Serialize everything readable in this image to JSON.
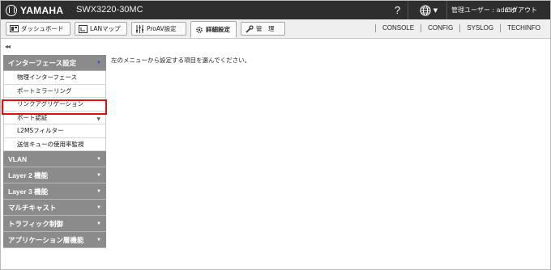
{
  "header": {
    "brand": "YAMAHA",
    "model": "SWX3220-30MC",
    "help": "?",
    "user_label": "管理ユーザー : admin",
    "logout": "ログアウト"
  },
  "nav": {
    "tabs": [
      {
        "label": "ダッシュボード",
        "icon": "dashboard-icon"
      },
      {
        "label": "LANマップ",
        "icon": "lanmap-icon"
      },
      {
        "label": "ProAV設定",
        "icon": "sliders-icon"
      },
      {
        "label": "詳細設定",
        "icon": "gear-icon",
        "active": true
      },
      {
        "label": "管　理",
        "icon": "wrench-icon"
      }
    ],
    "links": [
      "CONSOLE",
      "CONFIG",
      "SYSLOG",
      "TECHINFO"
    ]
  },
  "sidebar": {
    "collapse": "◂◂",
    "open_section": "インターフェース設定",
    "items": [
      "物理インターフェース",
      "ポートミラーリング",
      "リンクアグリゲーション",
      "ポート認証",
      "L2MSフィルター",
      "送信キューの使用率監視"
    ],
    "sections": [
      "VLAN",
      "Layer 2 機能",
      "Layer 3 機能",
      "マルチキャスト",
      "トラフィック制御",
      "アプリケーション層機能"
    ]
  },
  "main": {
    "message": "左のメニューから設定する項目を選んでください。"
  },
  "colors": {
    "header_bg": "#2e2e2e",
    "sidebar_head": "#8b8b8b",
    "highlight": "#e01010"
  }
}
